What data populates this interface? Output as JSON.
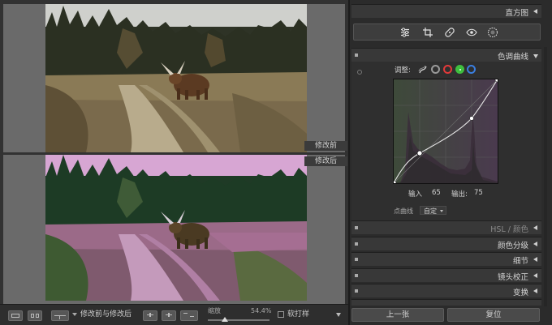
{
  "viewer": {
    "before_label": "修改前",
    "after_label": "修改后"
  },
  "toolbar": {
    "view_mode_label": "修改前与修改后",
    "zoom_label": "缩放",
    "zoom_value": "54.4%",
    "soft_proof_label": "软打样"
  },
  "panel": {
    "histogram_title": "直方图",
    "tools": [
      "sliders-icon",
      "crop-icon",
      "heal-icon",
      "redeye-icon",
      "radial-filter-icon"
    ],
    "tone_curve": {
      "title": "色调曲线",
      "adjust_label": "调整:",
      "channels": [
        {
          "name": "rgb",
          "color": "#9a9a9a"
        },
        {
          "name": "red",
          "color": "#e23a3a"
        },
        {
          "name": "green",
          "color": "#3fbf3f"
        },
        {
          "name": "blue",
          "color": "#3a7ee0"
        }
      ],
      "input_label": "输入",
      "input_value": "65",
      "output_label": "输出:",
      "output_value": "75",
      "point_curve_label": "点曲线",
      "point_curve_value": "自定"
    },
    "sections": [
      {
        "label": "HSL / 颜色",
        "enabled": false
      },
      {
        "label": "颜色分级",
        "enabled": true
      },
      {
        "label": "细节",
        "enabled": true
      },
      {
        "label": "镜头校正",
        "enabled": true
      },
      {
        "label": "变换",
        "enabled": true
      }
    ],
    "previous_button": "上一张",
    "reset_button": "复位"
  }
}
